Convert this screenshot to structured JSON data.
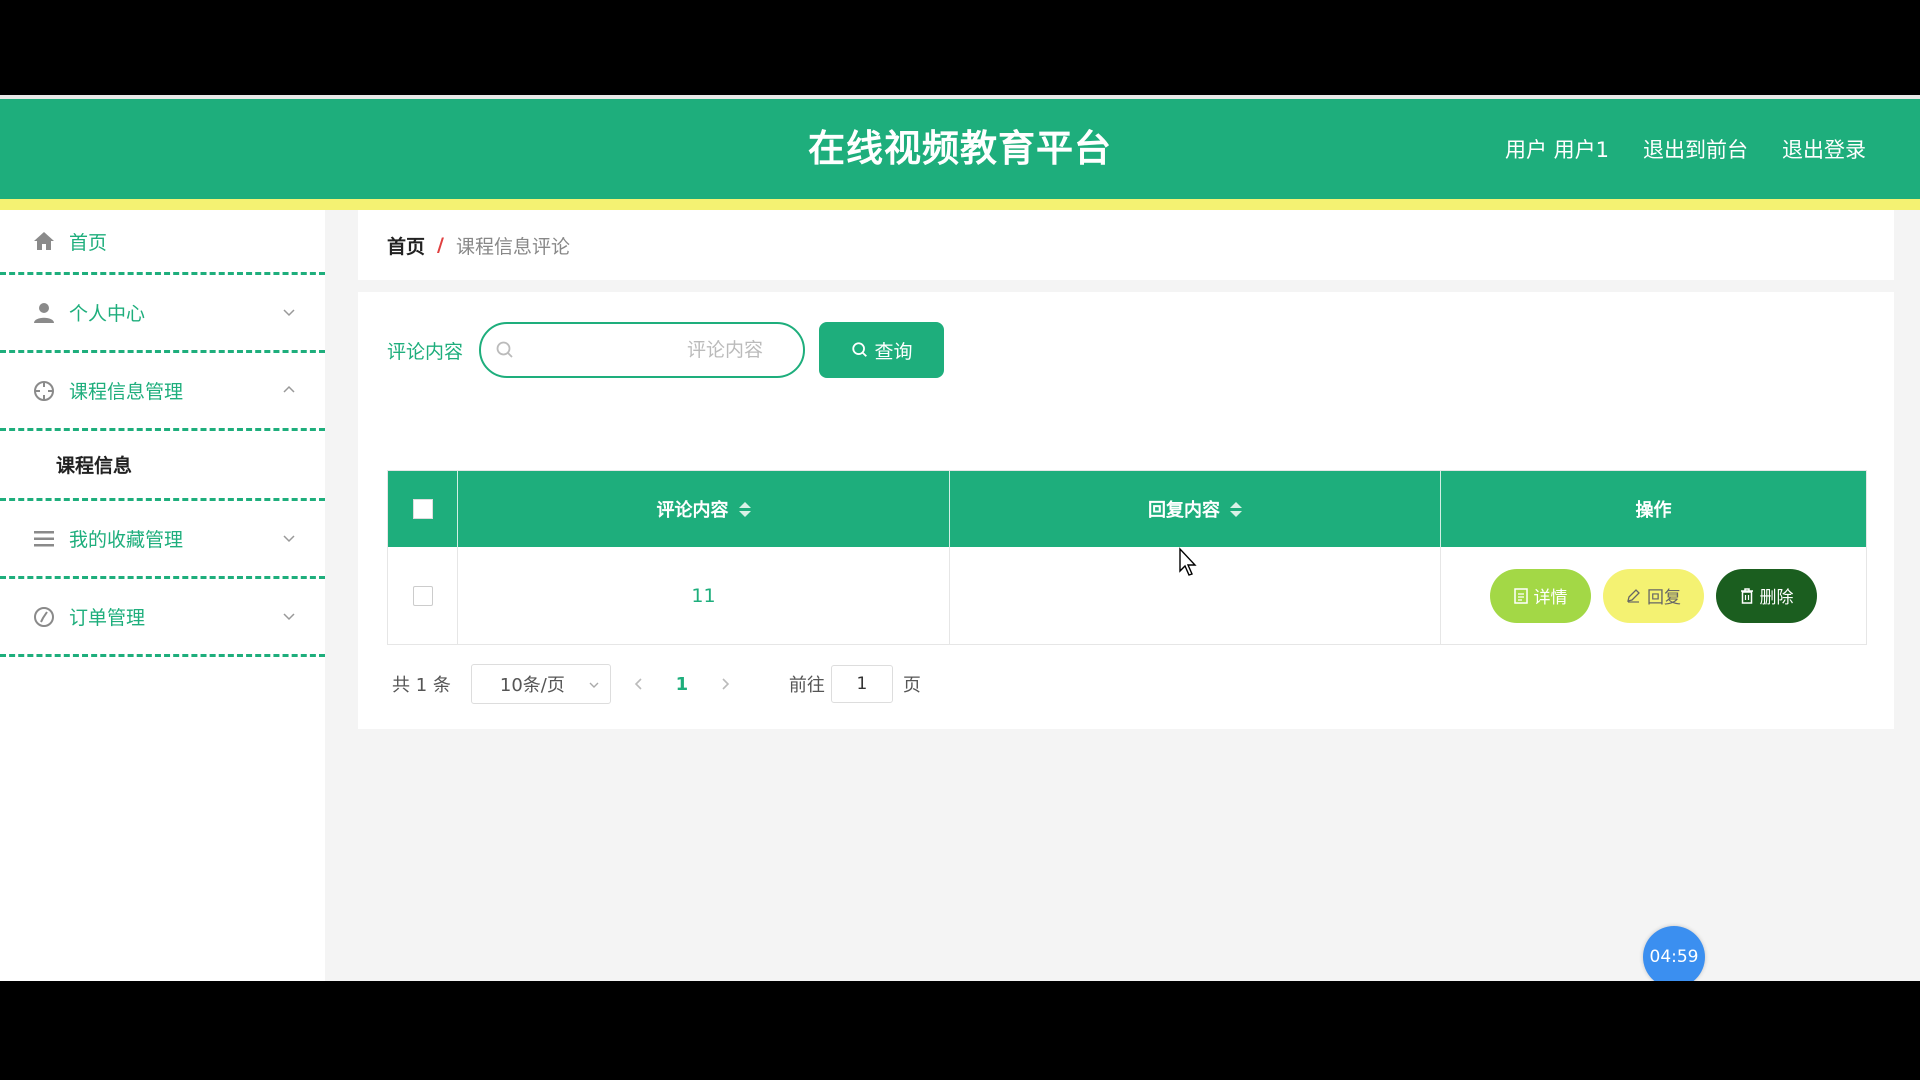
{
  "header": {
    "title": "在线视频教育平台",
    "user_label": "用户 用户1",
    "back_to_front": "退出到前台",
    "logout": "退出登录"
  },
  "sidebar": {
    "items": [
      {
        "label": "首页",
        "icon": "home-icon"
      },
      {
        "label": "个人中心",
        "icon": "user-icon"
      },
      {
        "label": "课程信息管理",
        "icon": "course-icon",
        "expanded": true,
        "children": [
          {
            "label": "课程信息"
          }
        ]
      },
      {
        "label": "我的收藏管理",
        "icon": "list-icon"
      },
      {
        "label": "订单管理",
        "icon": "order-icon"
      }
    ]
  },
  "breadcrumb": {
    "home": "首页",
    "separator": "/",
    "current": "课程信息评论"
  },
  "search": {
    "label": "评论内容",
    "placeholder": "评论内容",
    "value": "",
    "button": "查询"
  },
  "table": {
    "columns": [
      "评论内容",
      "回复内容",
      "操作"
    ],
    "rows": [
      {
        "comment": "11",
        "reply": "",
        "actions": [
          "详情",
          "回复",
          "删除"
        ]
      }
    ]
  },
  "pagination": {
    "total": "共 1 条",
    "page_size": "10条/页",
    "current_page": "1",
    "goto_label": "前往",
    "goto_value": "1",
    "page_suffix": "页"
  },
  "timer": "04:59",
  "colors": {
    "primary": "#1eae7c",
    "stripe": "#f4f272",
    "detail": "#a3d846",
    "reply": "#f4f272",
    "delete": "#1b5e1f",
    "timer": "#3b8ff0"
  }
}
